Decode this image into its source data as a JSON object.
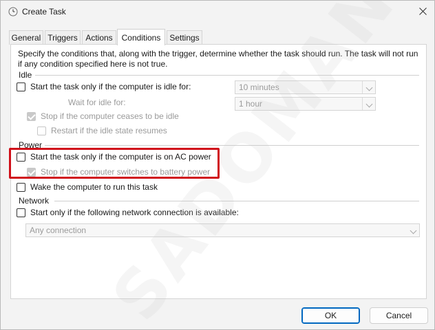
{
  "window": {
    "title": "Create Task"
  },
  "tabs": [
    {
      "label": "General"
    },
    {
      "label": "Triggers"
    },
    {
      "label": "Actions"
    },
    {
      "label": "Conditions"
    },
    {
      "label": "Settings"
    }
  ],
  "active_tab": "Conditions",
  "description": "Specify the conditions that, along with the trigger, determine whether the task should run.  The task will not run  if any condition specified here is not true.",
  "idle": {
    "group_label": "Idle",
    "start_if_idle_label": "Start the task only if the computer is idle for:",
    "start_if_idle_checked": false,
    "idle_for_value": "10 minutes",
    "wait_label": "Wait for idle for:",
    "wait_value": "1 hour",
    "stop_if_ceases_label": "Stop if the computer ceases to be idle",
    "stop_if_ceases_checked": true,
    "restart_label": "Restart if the idle state resumes",
    "restart_checked": false
  },
  "power": {
    "group_label": "Power",
    "ac_power_label": "Start the task only if the computer is on AC power",
    "ac_power_checked": false,
    "battery_label": "Stop if the computer switches to battery power",
    "battery_checked": true,
    "wake_label": "Wake the computer to run this task",
    "wake_checked": false
  },
  "network": {
    "group_label": "Network",
    "start_network_label": "Start only if the following network connection is available:",
    "start_network_checked": false,
    "connection_value": "Any connection"
  },
  "buttons": {
    "ok": "OK",
    "cancel": "Cancel"
  },
  "colors": {
    "highlight": "#d0101a",
    "primary_border": "#0067c0"
  },
  "watermark": {
    "text": "SADOMAN"
  }
}
